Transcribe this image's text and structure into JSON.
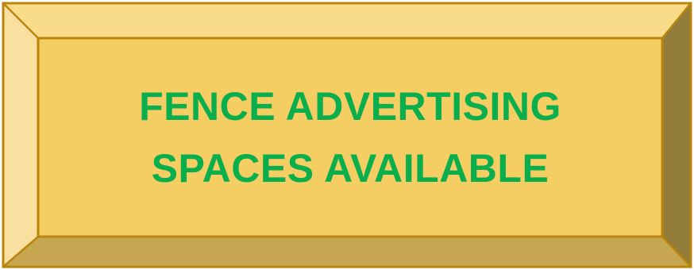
{
  "sign": {
    "line1": "FENCE ADVERTISING",
    "line2": "SPACES AVAILABLE"
  },
  "colors": {
    "text": "#0AAE4C",
    "face": "#F4CD63",
    "bevel_top": "#F8DC8A",
    "bevel_left": "#FAE0A0",
    "bevel_right": "#937D3B",
    "bevel_bottom": "#C7A651",
    "border": "#B8860B"
  }
}
